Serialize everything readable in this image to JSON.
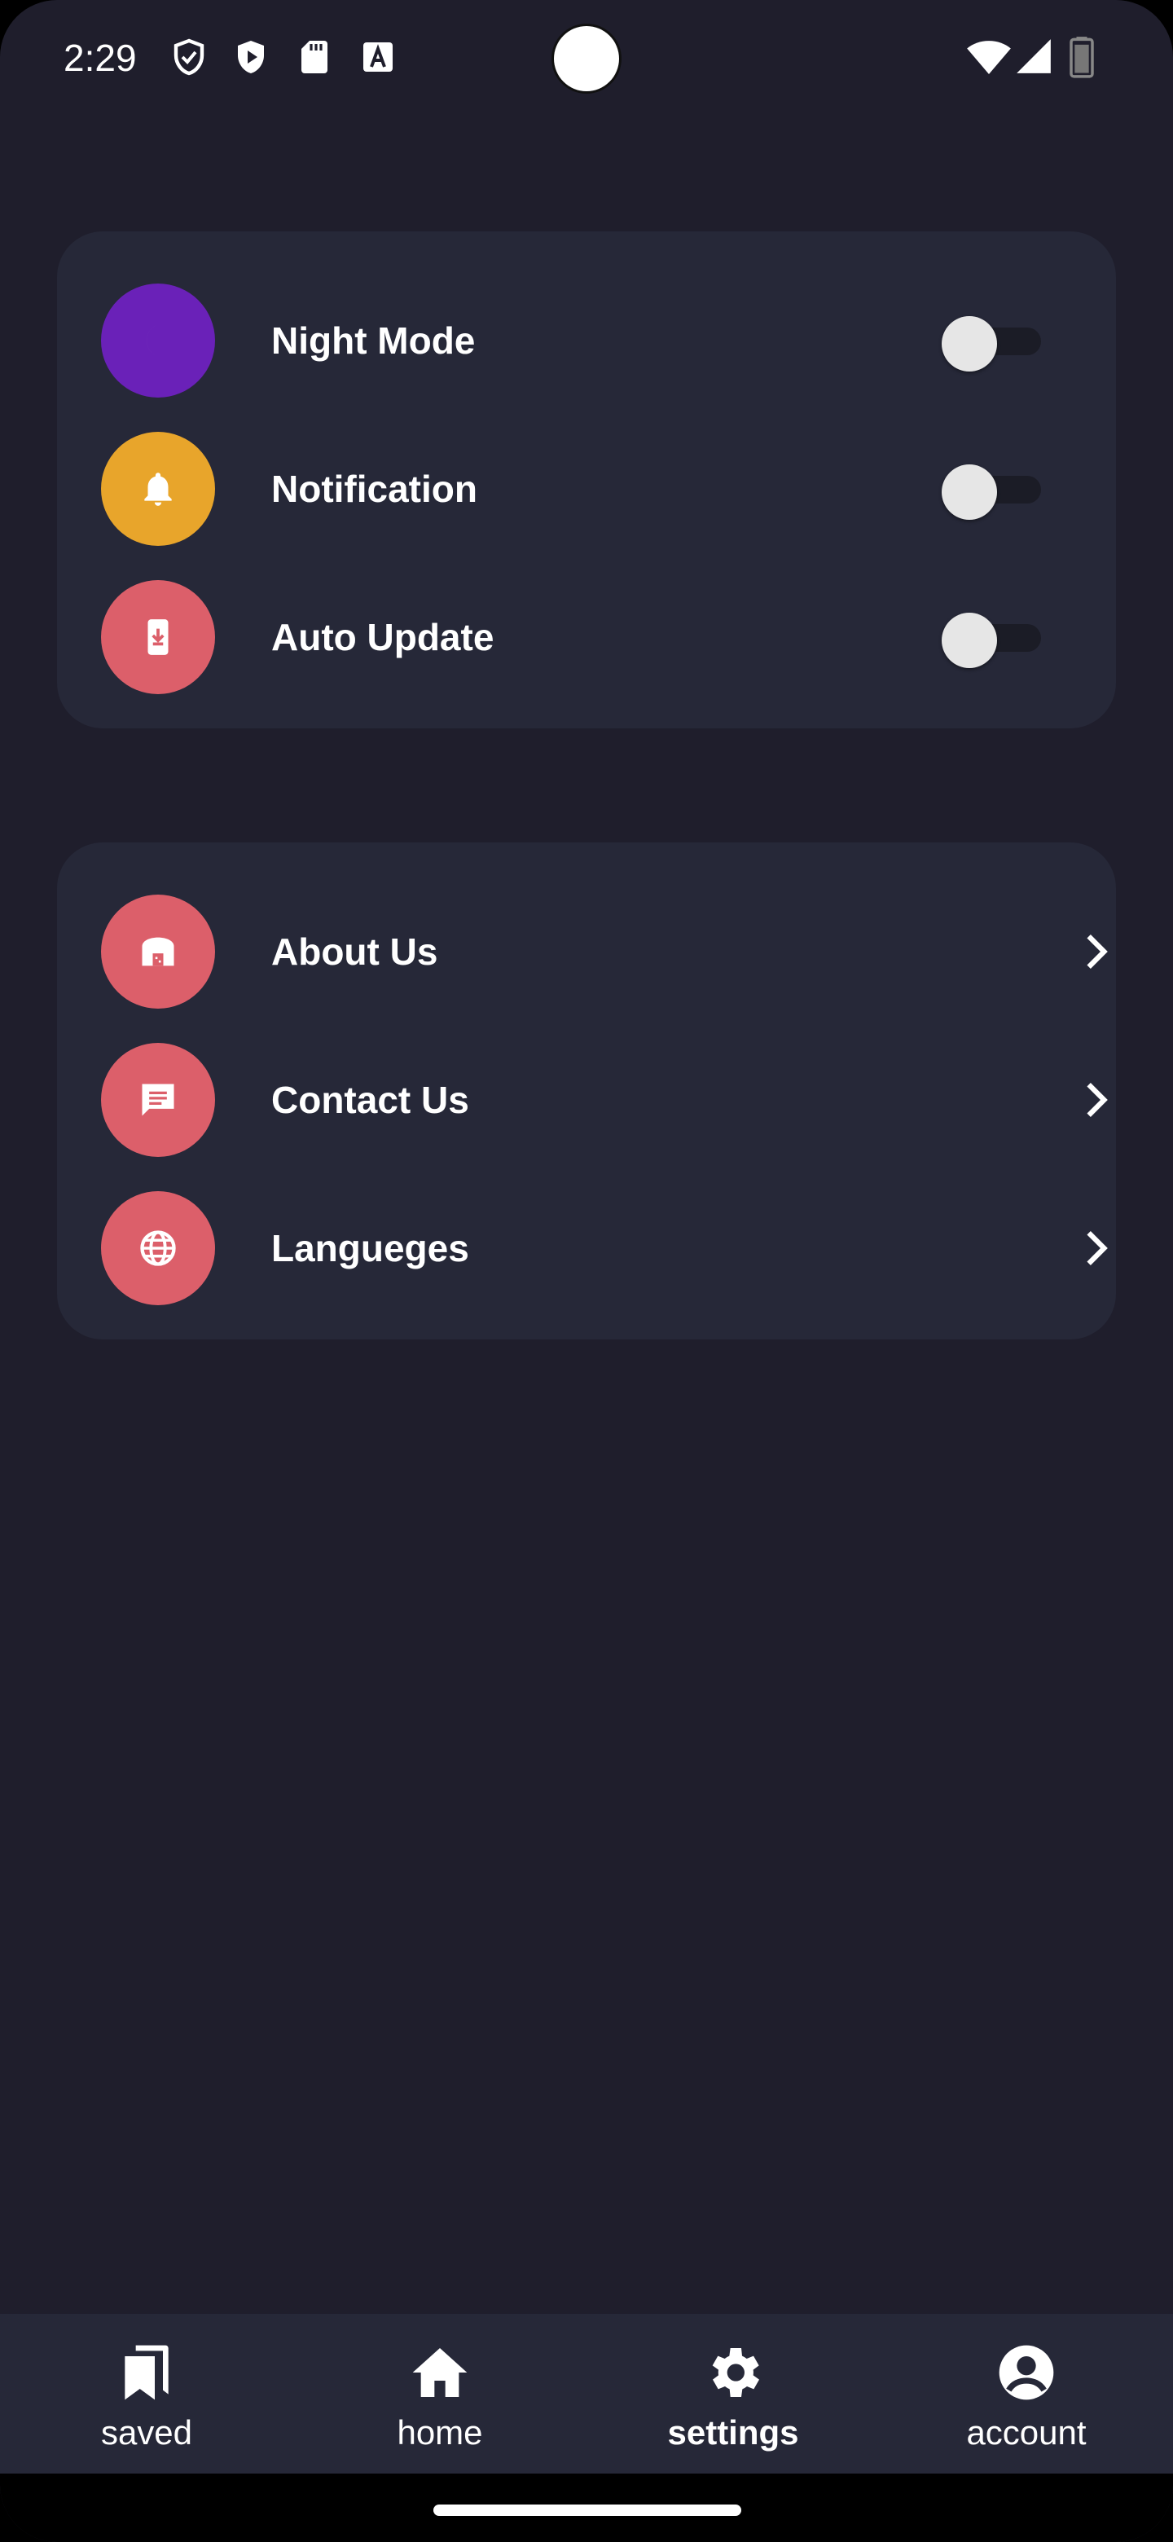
{
  "status_bar": {
    "time": "2:29",
    "icons": [
      "shield-outline-icon",
      "shield-play-icon",
      "sd-card-icon",
      "a-box-icon",
      "wifi-icon",
      "signal-icon",
      "battery-icon"
    ]
  },
  "toggles": [
    {
      "label": "Night Mode",
      "icon": "moon-icon",
      "color": "#6a21b8",
      "enabled": false
    },
    {
      "label": "Notification",
      "icon": "bell-icon",
      "color": "#e8a52b",
      "enabled": false
    },
    {
      "label": "Auto Update",
      "icon": "phone-download-icon",
      "color": "#dc5f6a",
      "enabled": false
    }
  ],
  "links": [
    {
      "label": "About Us",
      "icon": "store-icon",
      "color": "#dc5f6a"
    },
    {
      "label": "Contact Us",
      "icon": "message-icon",
      "color": "#dc5f6a"
    },
    {
      "label": "Langueges",
      "icon": "globe-icon",
      "color": "#dc5f6a"
    }
  ],
  "bottom_nav": [
    {
      "label": "saved",
      "icon": "bookmarks-icon",
      "active": false
    },
    {
      "label": "home",
      "icon": "home-icon",
      "active": false
    },
    {
      "label": "settings",
      "icon": "gear-icon",
      "active": true
    },
    {
      "label": "account",
      "icon": "account-circle-icon",
      "active": false
    }
  ]
}
